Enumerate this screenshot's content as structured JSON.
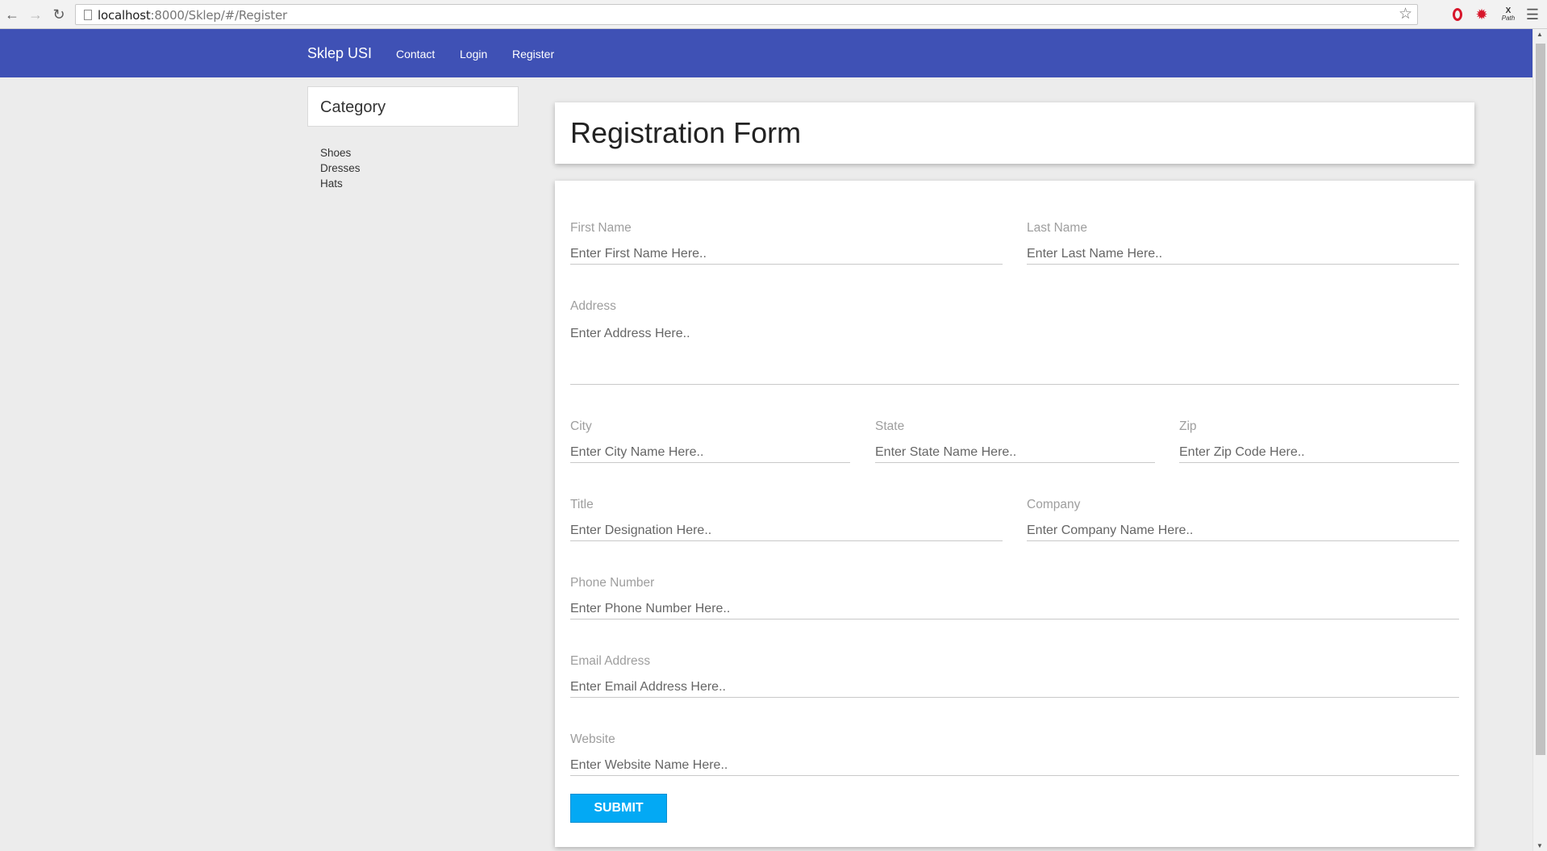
{
  "browser": {
    "url_host": "localhost",
    "url_path": ":8000/Sklep/#/Register",
    "ext_xpath_label": "X",
    "ext_xpath_sub": "Path"
  },
  "navbar": {
    "brand": "Sklep USI",
    "links": [
      "Contact",
      "Login",
      "Register"
    ],
    "color": "#3f51b5"
  },
  "sidebar": {
    "heading": "Category",
    "items": [
      "Shoes",
      "Dresses",
      "Hats"
    ]
  },
  "form": {
    "title": "Registration Form",
    "fields": {
      "first_name": {
        "label": "First Name",
        "placeholder": "Enter First Name Here.."
      },
      "last_name": {
        "label": "Last Name",
        "placeholder": "Enter Last Name Here.."
      },
      "address": {
        "label": "Address",
        "placeholder": "Enter Address Here.."
      },
      "city": {
        "label": "City",
        "placeholder": "Enter City Name Here.."
      },
      "state": {
        "label": "State",
        "placeholder": "Enter State Name Here.."
      },
      "zip": {
        "label": "Zip",
        "placeholder": "Enter Zip Code Here.."
      },
      "title": {
        "label": "Title",
        "placeholder": "Enter Designation Here.."
      },
      "company": {
        "label": "Company",
        "placeholder": "Enter Company Name Here.."
      },
      "phone": {
        "label": "Phone Number",
        "placeholder": "Enter Phone Number Here.."
      },
      "email": {
        "label": "Email Address",
        "placeholder": "Enter Email Address Here.."
      },
      "website": {
        "label": "Website",
        "placeholder": "Enter Website Name Here.."
      }
    },
    "submit_label": "SUBMIT",
    "submit_color": "#03a9f4"
  }
}
